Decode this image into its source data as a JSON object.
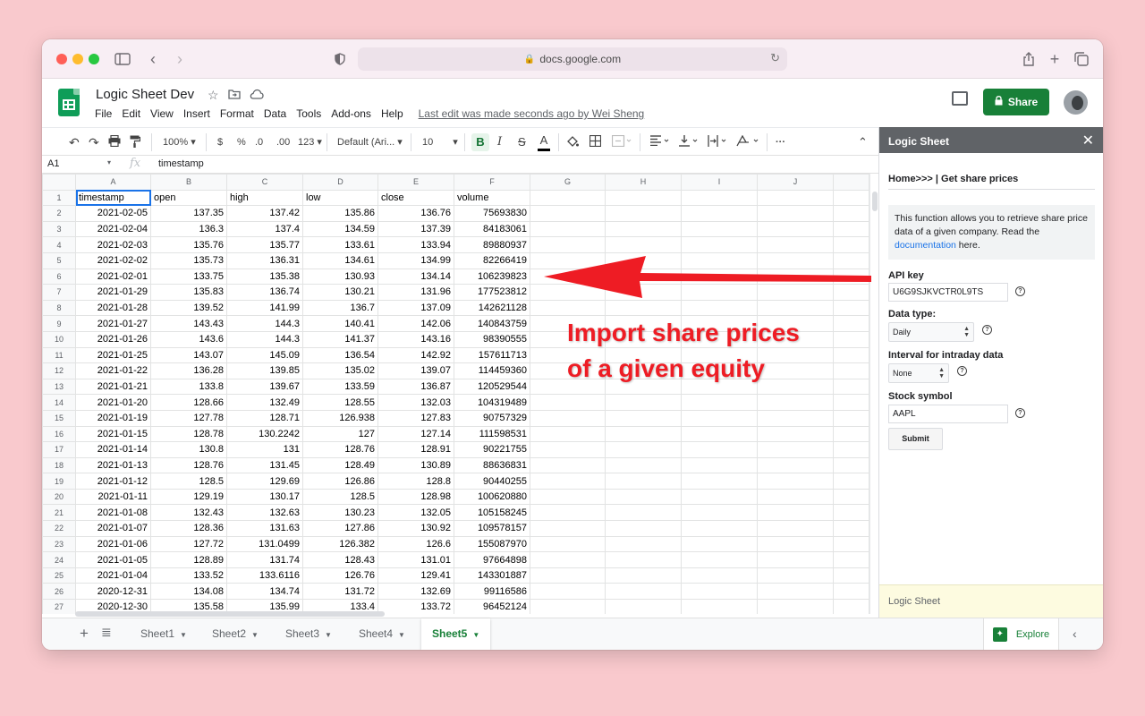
{
  "browser": {
    "url": "docs.google.com"
  },
  "app": {
    "title": "Logic Sheet Dev",
    "menu": [
      "File",
      "Edit",
      "View",
      "Insert",
      "Format",
      "Data",
      "Tools",
      "Add-ons",
      "Help"
    ],
    "last_edit": "Last edit was made seconds ago by Wei Sheng",
    "share_label": "Share",
    "share_color": "#188038"
  },
  "toolbar": {
    "zoom": "100%",
    "currency": "$",
    "percent": "%",
    "dec_decrease": ".0",
    "dec_increase": ".00",
    "number_format": "123",
    "font": "Default (Ari...",
    "font_size": "10",
    "bold": "B",
    "italic": "I",
    "strike": "S",
    "text_color": "A",
    "more": "···"
  },
  "formula": {
    "cell": "A1",
    "fx": "fx",
    "content": "timestamp"
  },
  "grid": {
    "columns": [
      "A",
      "B",
      "C",
      "D",
      "E",
      "F",
      "G",
      "H",
      "I",
      "J"
    ],
    "header_row": [
      "timestamp",
      "open",
      "high",
      "low",
      "close",
      "volume"
    ],
    "rows": [
      [
        "2021-02-05",
        "137.35",
        "137.42",
        "135.86",
        "136.76",
        "75693830"
      ],
      [
        "2021-02-04",
        "136.3",
        "137.4",
        "134.59",
        "137.39",
        "84183061"
      ],
      [
        "2021-02-03",
        "135.76",
        "135.77",
        "133.61",
        "133.94",
        "89880937"
      ],
      [
        "2021-02-02",
        "135.73",
        "136.31",
        "134.61",
        "134.99",
        "82266419"
      ],
      [
        "2021-02-01",
        "133.75",
        "135.38",
        "130.93",
        "134.14",
        "106239823"
      ],
      [
        "2021-01-29",
        "135.83",
        "136.74",
        "130.21",
        "131.96",
        "177523812"
      ],
      [
        "2021-01-28",
        "139.52",
        "141.99",
        "136.7",
        "137.09",
        "142621128"
      ],
      [
        "2021-01-27",
        "143.43",
        "144.3",
        "140.41",
        "142.06",
        "140843759"
      ],
      [
        "2021-01-26",
        "143.6",
        "144.3",
        "141.37",
        "143.16",
        "98390555"
      ],
      [
        "2021-01-25",
        "143.07",
        "145.09",
        "136.54",
        "142.92",
        "157611713"
      ],
      [
        "2021-01-22",
        "136.28",
        "139.85",
        "135.02",
        "139.07",
        "114459360"
      ],
      [
        "2021-01-21",
        "133.8",
        "139.67",
        "133.59",
        "136.87",
        "120529544"
      ],
      [
        "2021-01-20",
        "128.66",
        "132.49",
        "128.55",
        "132.03",
        "104319489"
      ],
      [
        "2021-01-19",
        "127.78",
        "128.71",
        "126.938",
        "127.83",
        "90757329"
      ],
      [
        "2021-01-15",
        "128.78",
        "130.2242",
        "127",
        "127.14",
        "111598531"
      ],
      [
        "2021-01-14",
        "130.8",
        "131",
        "128.76",
        "128.91",
        "90221755"
      ],
      [
        "2021-01-13",
        "128.76",
        "131.45",
        "128.49",
        "130.89",
        "88636831"
      ],
      [
        "2021-01-12",
        "128.5",
        "129.69",
        "126.86",
        "128.8",
        "90440255"
      ],
      [
        "2021-01-11",
        "129.19",
        "130.17",
        "128.5",
        "128.98",
        "100620880"
      ],
      [
        "2021-01-08",
        "132.43",
        "132.63",
        "130.23",
        "132.05",
        "105158245"
      ],
      [
        "2021-01-07",
        "128.36",
        "131.63",
        "127.86",
        "130.92",
        "109578157"
      ],
      [
        "2021-01-06",
        "127.72",
        "131.0499",
        "126.382",
        "126.6",
        "155087970"
      ],
      [
        "2021-01-05",
        "128.89",
        "131.74",
        "128.43",
        "131.01",
        "97664898"
      ],
      [
        "2021-01-04",
        "133.52",
        "133.6116",
        "126.76",
        "129.41",
        "143301887"
      ],
      [
        "2020-12-31",
        "134.08",
        "134.74",
        "131.72",
        "132.69",
        "99116586"
      ],
      [
        "2020-12-30",
        "135.58",
        "135.99",
        "133.4",
        "133.72",
        "96452124"
      ]
    ]
  },
  "tabs": {
    "items": [
      "Sheet1",
      "Sheet2",
      "Sheet3",
      "Sheet4",
      "Sheet5"
    ],
    "active": "Sheet5",
    "explore": "Explore"
  },
  "sidebar": {
    "title": "Logic Sheet",
    "breadcrumb": "Home>>> | Get share prices",
    "info_text": "This function allows you to retrieve share price data of a given company. Read the ",
    "info_link": "documentation",
    "info_suffix": " here.",
    "api_key_label": "API key",
    "api_key_value": "U6G9SJKVCTR0L9TS",
    "data_type_label": "Data type:",
    "data_type_value": "Daily",
    "interval_label": "Interval for intraday data",
    "interval_value": "None",
    "symbol_label": "Stock symbol",
    "symbol_value": "AAPL",
    "submit_label": "Submit",
    "footer": "Logic Sheet"
  },
  "annotation": {
    "line1": "Import share prices",
    "line2": "of a given equity",
    "color": "#ee1c24"
  }
}
